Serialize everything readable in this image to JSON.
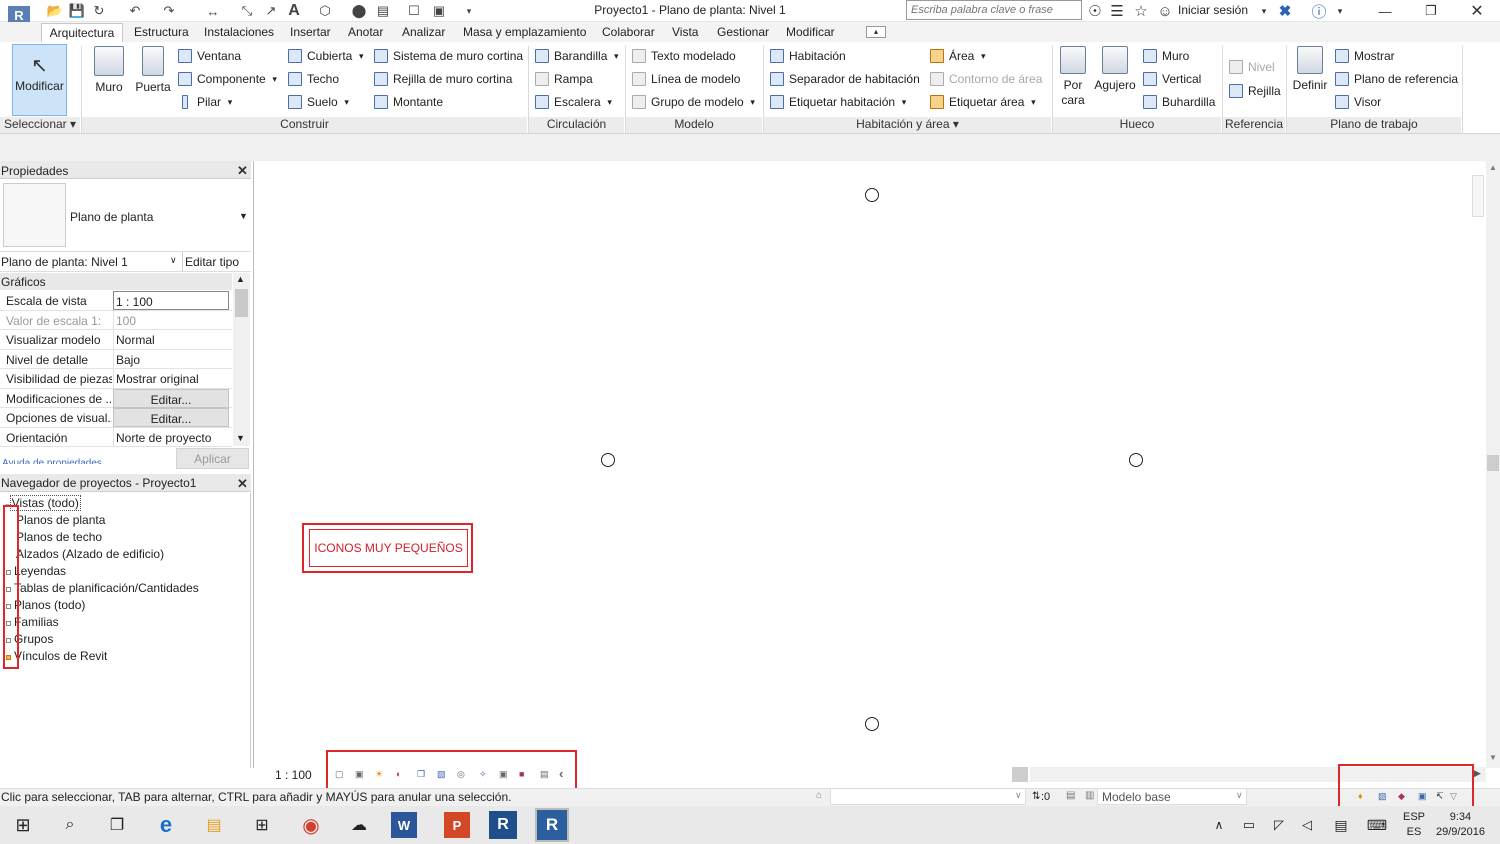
{
  "window": {
    "title": "Proyecto1 - Plano de planta: Nivel 1",
    "search_placeholder": "Escriba palabra clave o frase",
    "signin": "Iniciar sesión",
    "app_logo": "R"
  },
  "tabs": [
    "Arquitectura",
    "Estructura",
    "Instalaciones",
    "Insertar",
    "Anotar",
    "Analizar",
    "Masa y emplazamiento",
    "Colaborar",
    "Vista",
    "Gestionar",
    "Modificar"
  ],
  "ribbon": {
    "seleccionar": {
      "modificar": "Modificar",
      "label": "Seleccionar"
    },
    "construir": {
      "label": "Construir",
      "muro": "Muro",
      "puerta": "Puerta",
      "col1": [
        "Ventana",
        "Componente",
        "Pilar"
      ],
      "col2": [
        "Cubierta",
        "Techo",
        "Suelo"
      ],
      "col3": [
        "Sistema de muro cortina",
        "Rejilla de muro cortina",
        "Montante"
      ]
    },
    "circulacion": {
      "label": "Circulación",
      "items": [
        "Barandilla",
        "Rampa",
        "Escalera"
      ]
    },
    "modelo": {
      "label": "Modelo",
      "items": [
        "Texto modelado",
        "Línea de modelo",
        "Grupo de modelo"
      ]
    },
    "habitacion": {
      "label": "Habitación y área",
      "col1": [
        "Habitación",
        "Separador  de habitación",
        "Etiquetar  habitación"
      ],
      "col2": [
        "Área",
        "Contorno  de área",
        "Etiquetar  área"
      ]
    },
    "hueco": {
      "label": "Hueco",
      "porcara": "Por cara",
      "agujero": "Agujero",
      "items": [
        "Muro",
        "Vertical",
        "Buhardilla"
      ]
    },
    "referencia": {
      "label": "Referencia",
      "items": [
        "Nivel",
        "Rejilla"
      ]
    },
    "plano_trabajo": {
      "label": "Plano de trabajo",
      "definir": "Definir",
      "items": [
        "Mostrar",
        "Plano de referencia",
        "Visor"
      ]
    }
  },
  "properties": {
    "title": "Propiedades",
    "type_name": "Plano de planta",
    "instance": "Plano de planta: Nivel 1",
    "edit_type": "Editar tipo",
    "group": "Gráficos",
    "rows": [
      {
        "label": "Escala de vista",
        "value": "1 : 100"
      },
      {
        "label": "Valor de escala    1:",
        "value": "100"
      },
      {
        "label": "Visualizar modelo",
        "value": "Normal"
      },
      {
        "label": "Nivel de detalle",
        "value": "Bajo"
      },
      {
        "label": "Visibilidad de piezas",
        "value": "Mostrar original"
      },
      {
        "label": "Modificaciones de ...",
        "value": "Editar..."
      },
      {
        "label": "Opciones de visual...",
        "value": "Editar..."
      },
      {
        "label": "Orientación",
        "value": "Norte de proyecto"
      }
    ],
    "help_link": "Ayuda de propiedades",
    "apply": "Aplicar"
  },
  "browser": {
    "title": "Navegador de proyectos - Proyecto1",
    "items": [
      "Vistas (todo)",
      "Planos de planta",
      "Planos de techo",
      "Alzados (Alzado de edificio)",
      "Leyendas",
      "Tablas de planificación/Cantidades",
      "Planos (todo)",
      "Familias",
      "Grupos",
      "Vínculos de Revit"
    ]
  },
  "annotation": "ICONOS MUY PEQUEÑOS",
  "view": {
    "scale": "1 : 100"
  },
  "status": {
    "text": "Clic para seleccionar, TAB para alternar, CTRL para añadir y MAYÚS para anular una selección.",
    "zero": ":0",
    "model": "Modelo base"
  },
  "taskbar": {
    "lang1": "ESP",
    "lang2": "ES",
    "time": "9:34",
    "date": "29/9/2016"
  }
}
